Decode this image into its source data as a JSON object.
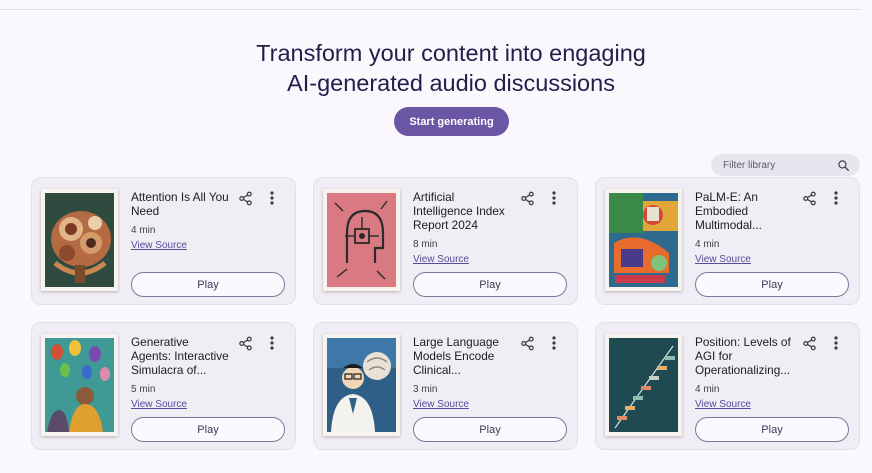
{
  "hero": {
    "title_line1": "Transform your content into engaging",
    "title_line2": "AI-generated audio discussions",
    "start_button": "Start generating"
  },
  "library": {
    "filter_placeholder": "Filter library"
  },
  "colors": {
    "accent": "#6b55a5",
    "background": "#fbf8fd",
    "card": "#f0edf4",
    "link": "#5a4a9a"
  },
  "cards": [
    {
      "title": "Attention Is All You Need",
      "duration": "4 min",
      "source_label": "View Source",
      "play_label": "Play",
      "thumbnail": "mechanical-brain-gears-illustration"
    },
    {
      "title": "Artificial Intelligence Index Report 2024",
      "duration": "8 min",
      "source_label": "View Source",
      "play_label": "Play",
      "thumbnail": "circuit-head-on-pink-illustration"
    },
    {
      "title": "PaLM-E: An Embodied Multimodal...",
      "duration": "4 min",
      "source_label": "View Source",
      "play_label": "Play",
      "thumbnail": "colorful-robot-collage-illustration"
    },
    {
      "title": "Generative Agents: Interactive Simulacra of...",
      "duration": "5 min",
      "source_label": "View Source",
      "play_label": "Play",
      "thumbnail": "people-with-colorful-balloons-illustration"
    },
    {
      "title": "Large Language Models Encode Clinical...",
      "duration": "3 min",
      "source_label": "View Source",
      "play_label": "Play",
      "thumbnail": "doctor-with-brain-illustration"
    },
    {
      "title": "Position: Levels of AGI for Operationalizing...",
      "duration": "4 min",
      "source_label": "View Source",
      "play_label": "Play",
      "thumbnail": "staircase-on-teal-wall-illustration"
    }
  ]
}
